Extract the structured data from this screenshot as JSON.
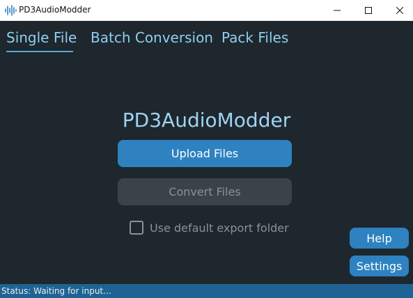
{
  "window": {
    "title": "PD3AudioModder",
    "icon": "waveform-icon",
    "controls": [
      "minimize-icon",
      "maximize-icon",
      "close-icon"
    ]
  },
  "tabs": [
    {
      "label": "Single File",
      "active": true
    },
    {
      "label": "Batch Conversion",
      "active": false
    },
    {
      "label": "Pack Files",
      "active": false
    }
  ],
  "main": {
    "heading": "PD3AudioModder",
    "upload_label": "Upload Files",
    "convert_label": "Convert Files",
    "convert_enabled": false,
    "default_export_label": "Use default export folder",
    "default_export_checked": false
  },
  "side_buttons": {
    "help_label": "Help",
    "settings_label": "Settings"
  },
  "status": {
    "text": "Status: Waiting for input..."
  },
  "colors": {
    "background": "#1e272d",
    "accent": "#2e82c0",
    "tab_text": "#8ecff0",
    "heading_text": "#9fd3f2",
    "disabled_bg": "#3a4347",
    "disabled_text": "#8a9296",
    "statusbar": "#1f6394"
  }
}
